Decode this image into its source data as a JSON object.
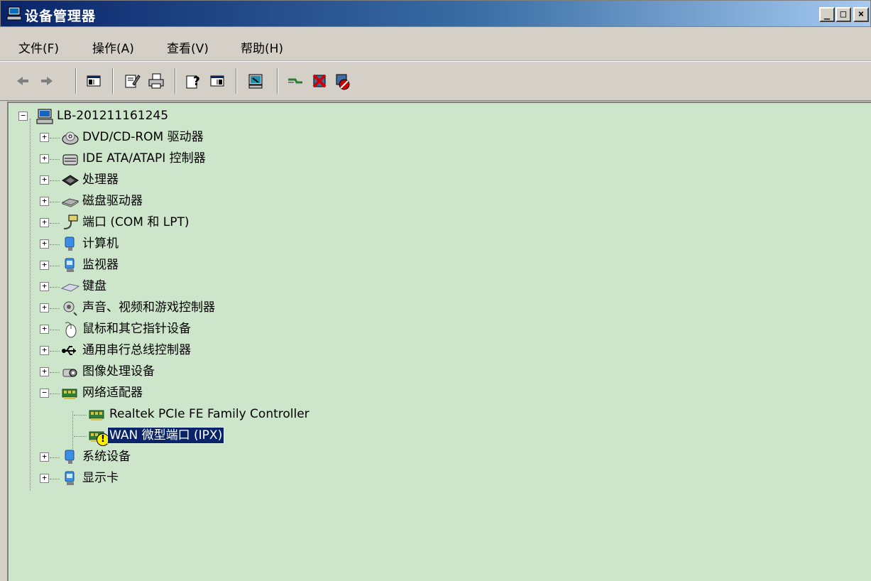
{
  "window": {
    "title": "设备管理器",
    "min_label": "_",
    "max_label": "□",
    "close_label": "×"
  },
  "menu": [
    "文件(F)",
    "操作(A)",
    "查看(V)",
    "帮助(H)"
  ],
  "toolbar": {
    "buttons": [
      "back",
      "forward",
      "show-hide-console-tree",
      "properties",
      "print",
      "help",
      "show-hide-action-pane",
      "scan-hardware-changes",
      "update-driver",
      "uninstall",
      "disable"
    ]
  },
  "tree": {
    "root": "LB-201211161245",
    "categories": [
      {
        "label": "DVD/CD-ROM 驱动器",
        "icon": "cdrom-icon"
      },
      {
        "label": "IDE ATA/ATAPI 控制器",
        "icon": "ide-controller-icon"
      },
      {
        "label": "处理器",
        "icon": "processor-icon"
      },
      {
        "label": "磁盘驱动器",
        "icon": "disk-drive-icon"
      },
      {
        "label": "端口 (COM 和 LPT)",
        "icon": "port-icon"
      },
      {
        "label": "计算机",
        "icon": "computer-icon"
      },
      {
        "label": "监视器",
        "icon": "monitor-icon"
      },
      {
        "label": "键盘",
        "icon": "keyboard-icon"
      },
      {
        "label": "声音、视频和游戏控制器",
        "icon": "sound-icon"
      },
      {
        "label": "鼠标和其它指针设备",
        "icon": "mouse-icon"
      },
      {
        "label": "通用串行总线控制器",
        "icon": "usb-icon"
      },
      {
        "label": "图像处理设备",
        "icon": "imaging-icon"
      },
      {
        "label": "网络适配器",
        "icon": "network-adapter-icon"
      }
    ],
    "network_children": [
      {
        "label": "Realtek PCIe FE Family Controller",
        "icon": "network-card-icon",
        "warning": false
      },
      {
        "label": "WAN 微型端口 (IPX)",
        "icon": "network-card-icon",
        "warning": true
      }
    ],
    "after": [
      {
        "label": "系统设备",
        "icon": "system-device-icon"
      },
      {
        "label": "显示卡",
        "icon": "display-adapter-icon"
      }
    ],
    "expander_plus": "+",
    "expander_minus": "−",
    "warning_mark": "!"
  }
}
